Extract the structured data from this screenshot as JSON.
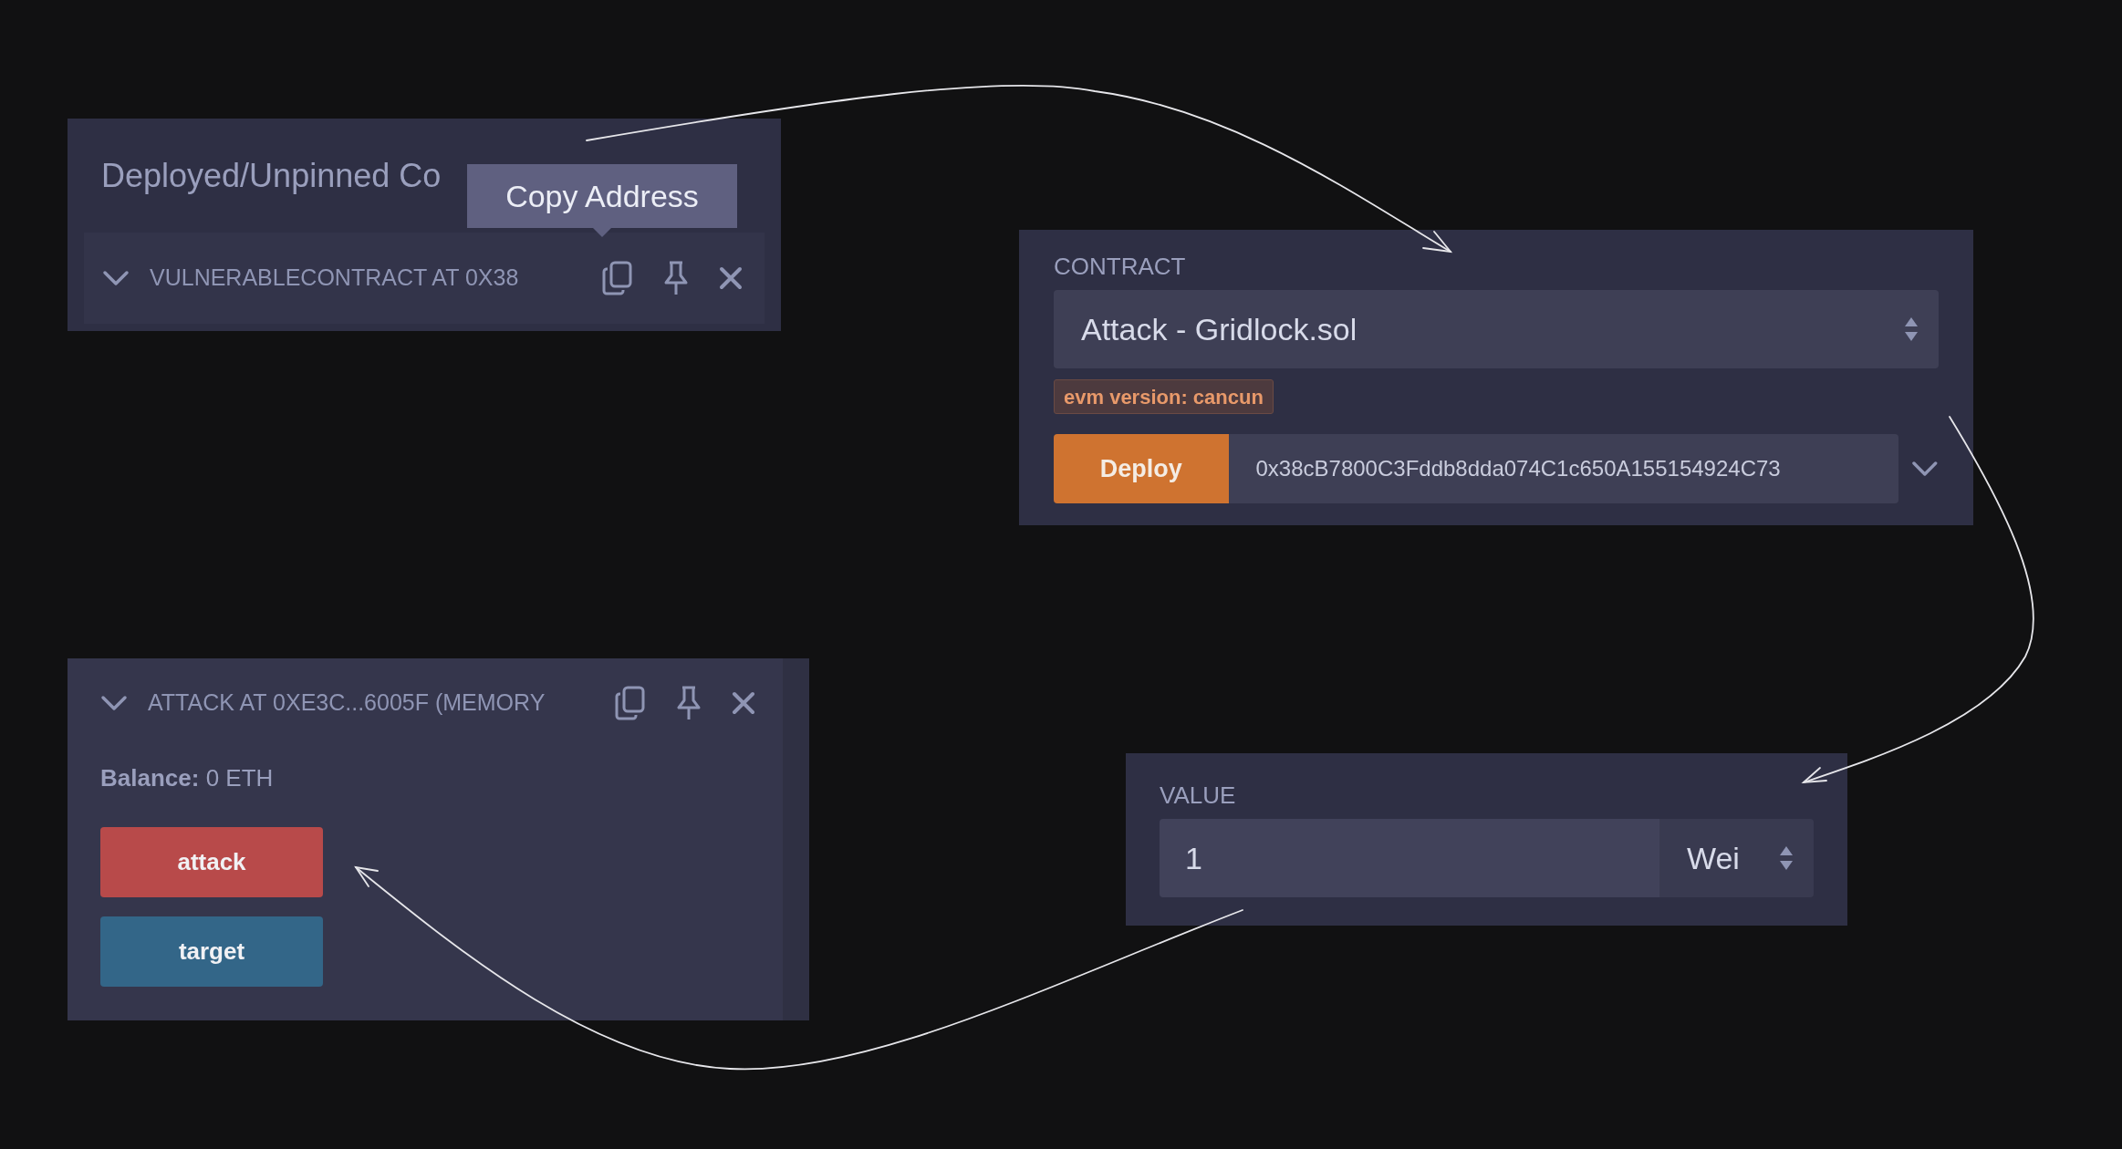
{
  "deployed_panel": {
    "title": "Deployed/Unpinned Co",
    "tooltip": "Copy Address",
    "instance": {
      "label": "VULNERABLECONTRACT AT 0X38"
    }
  },
  "contract_panel": {
    "label": "CONTRACT",
    "selected_contract": "Attack - Gridlock.sol",
    "evm_badge": "evm version: cancun",
    "deploy_button": "Deploy",
    "deploy_address": "0x38cB7800C3Fddb8dda074C1c650A155154924C73"
  },
  "instance_panel": {
    "label": "ATTACK AT 0XE3C...6005F (MEMORY",
    "balance_label": "Balance:",
    "balance": "0 ETH",
    "functions": [
      {
        "label": "attack",
        "kind": "transact"
      },
      {
        "label": "target",
        "kind": "call"
      }
    ]
  },
  "value_panel": {
    "label": "VALUE",
    "value": "1",
    "unit": "Wei"
  }
}
